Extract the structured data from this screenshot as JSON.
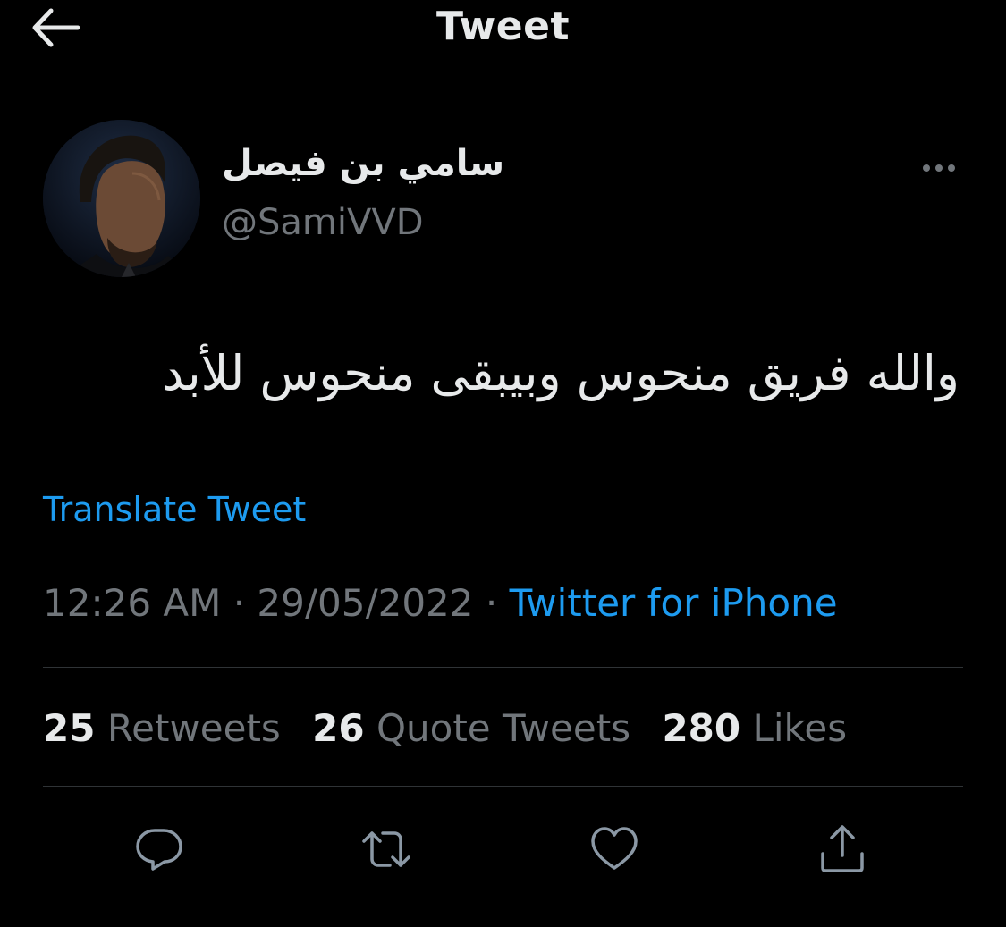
{
  "header": {
    "title": "Tweet",
    "back_icon": "arrow-left-icon"
  },
  "author": {
    "display_name": "سامي بن فيصل",
    "handle": "@SamiVVD",
    "more_icon": "more-dots-icon"
  },
  "tweet": {
    "text": "والله فريق منحوس وبيبقى منحوس للأبد",
    "translate_label": "Translate Tweet"
  },
  "meta": {
    "time": "12:26 AM",
    "separator": " · ",
    "date": "29/05/2022",
    "source": "Twitter for iPhone"
  },
  "stats": {
    "retweets_count": "25",
    "retweets_label": "Retweets",
    "quotes_count": "26",
    "quotes_label": "Quote Tweets",
    "likes_count": "280",
    "likes_label": "Likes"
  },
  "actions": [
    "reply-icon",
    "retweet-icon",
    "like-icon",
    "share-icon"
  ],
  "colors": {
    "background": "#000000",
    "text_primary": "#e7e9ea",
    "text_secondary": "#71767b",
    "link": "#1d9bf0",
    "divider": "#2f3336"
  }
}
